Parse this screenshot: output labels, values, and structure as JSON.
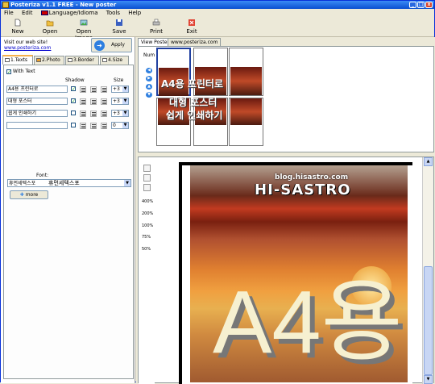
{
  "window": {
    "title": "Posteriza v1.1 FREE - New poster"
  },
  "menu": [
    "File",
    "Edit",
    "Language/Idioma",
    "Tools",
    "Help"
  ],
  "toolbar": {
    "new": "New",
    "open": "Open",
    "open_image": "Open Image",
    "save": "Save",
    "print": "Print",
    "exit": "Exit"
  },
  "left": {
    "visit_text": "Visit our web site!",
    "visit_link": "www.posteriza.com",
    "apply": "Apply",
    "tabs": [
      "1.Texts",
      "2.Photo",
      "3.Border",
      "4.Size"
    ],
    "with_text": "With Text",
    "shadow_header": "Shadow",
    "size_header": "Size",
    "rows": [
      {
        "text": "A4용 프린터로",
        "shadow": true,
        "size": "+3"
      },
      {
        "text": "대형 포스터",
        "shadow": true,
        "size": "+3"
      },
      {
        "text": "쉽게 인쇄하기",
        "shadow": false,
        "size": "+3"
      },
      {
        "text": "",
        "shadow": false,
        "size": "0"
      }
    ],
    "font_label": "Font:",
    "font_value": "휴먼세텍스포",
    "font_preview": "휴먼세텍스포",
    "more": "more"
  },
  "right": {
    "tabs": [
      "View Poster",
      "www.posteriza.com"
    ],
    "num_label": "Num",
    "thumb_texts": [
      "A4용 프린터로",
      "대형 포스터",
      "쉽게 인쇄하기"
    ],
    "zoom_levels": [
      "400%",
      "200%",
      "100%",
      "75%",
      "50%"
    ],
    "watermark": "blog.hisastro.com",
    "logo_text": "HI-SASTRO",
    "big_text": "A4용"
  }
}
